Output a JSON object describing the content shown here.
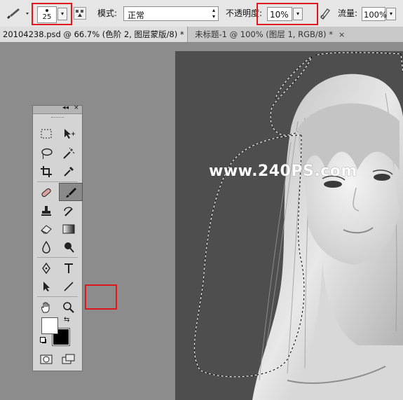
{
  "options_bar": {
    "brush_size": "25",
    "mode_label": "模式:",
    "mode_value": "正常",
    "opacity_label": "不透明度:",
    "opacity_value": "10%",
    "flow_label": "流量:",
    "flow_value": "100%"
  },
  "tabs": [
    {
      "label": "20104238.psd @ 66.7% (色阶 2, 图层蒙版/8) *",
      "close": "×",
      "active": true
    },
    {
      "label": "未标题-1 @ 100% (图层 1, RGB/8) *",
      "close": "×",
      "active": false
    }
  ],
  "toolbox": {
    "collapse": "◂◂",
    "close": "×",
    "tools": [
      "rect-marquee",
      "move",
      "lasso",
      "magic-wand",
      "crop",
      "eyedropper",
      "healing-brush",
      "brush",
      "clone-stamp",
      "history-brush",
      "eraser",
      "gradient",
      "blur",
      "dodge",
      "pen",
      "type",
      "path-selection",
      "line",
      "hand",
      "zoom"
    ],
    "selected_tool": "brush",
    "foreground_color": "#ffffff",
    "background_color": "#000000"
  },
  "canvas": {
    "watermark": "www.240PS.com",
    "background_color": "#4e4e4e"
  },
  "highlight_color": "#e0161e"
}
